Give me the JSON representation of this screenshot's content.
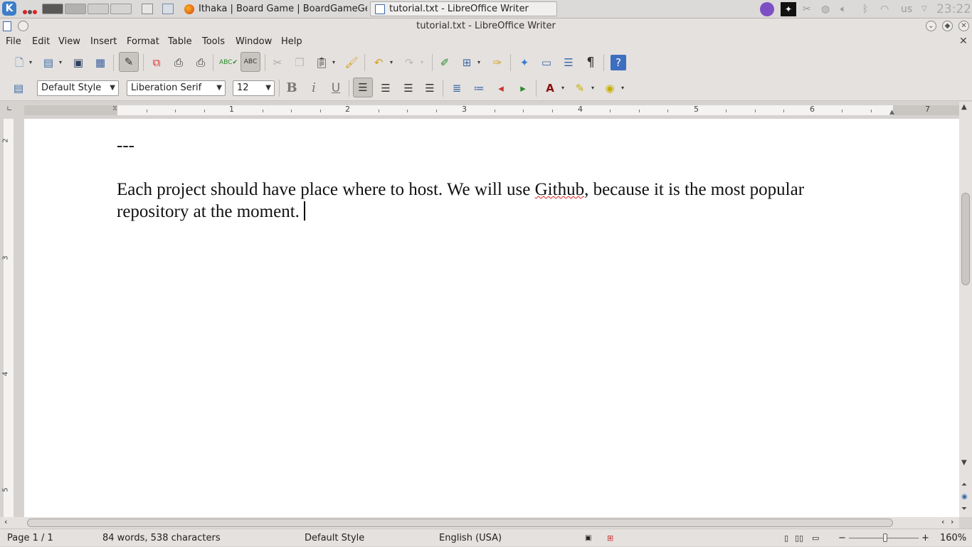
{
  "taskbar": {
    "tasks": [
      {
        "label": "Ithaka | Board Game | BoardGameGeek - Mozilla Firefox"
      },
      {
        "label": "tutorial.txt - LibreOffice Writer"
      }
    ],
    "keyboard_layout": "us",
    "clock": "23:22"
  },
  "window": {
    "title": "tutorial.txt - LibreOffice Writer"
  },
  "menubar": {
    "items": [
      "File",
      "Edit",
      "View",
      "Insert",
      "Format",
      "Table",
      "Tools",
      "Window",
      "Help"
    ]
  },
  "formatting": {
    "paragraph_style": "Default Style",
    "font_name": "Liberation Serif",
    "font_size": "12"
  },
  "ruler": {
    "marks": [
      "1",
      "2",
      "3",
      "4",
      "5",
      "6",
      "7"
    ],
    "vmarks": [
      "2",
      "3",
      "4",
      "5"
    ]
  },
  "document": {
    "separator": "---",
    "para_part1": "Each project should have place where to host. We will use ",
    "misspelled": "Github",
    "para_part2": ", because it is the most popular",
    "line2": "repository at the moment."
  },
  "status": {
    "page": "Page 1 / 1",
    "counts": "84 words, 538 characters",
    "page_style": "Default Style",
    "language": "English (USA)",
    "zoom": "160%"
  },
  "colors": {
    "accent": "#3d7dc9",
    "spell_error": "#e02020"
  }
}
